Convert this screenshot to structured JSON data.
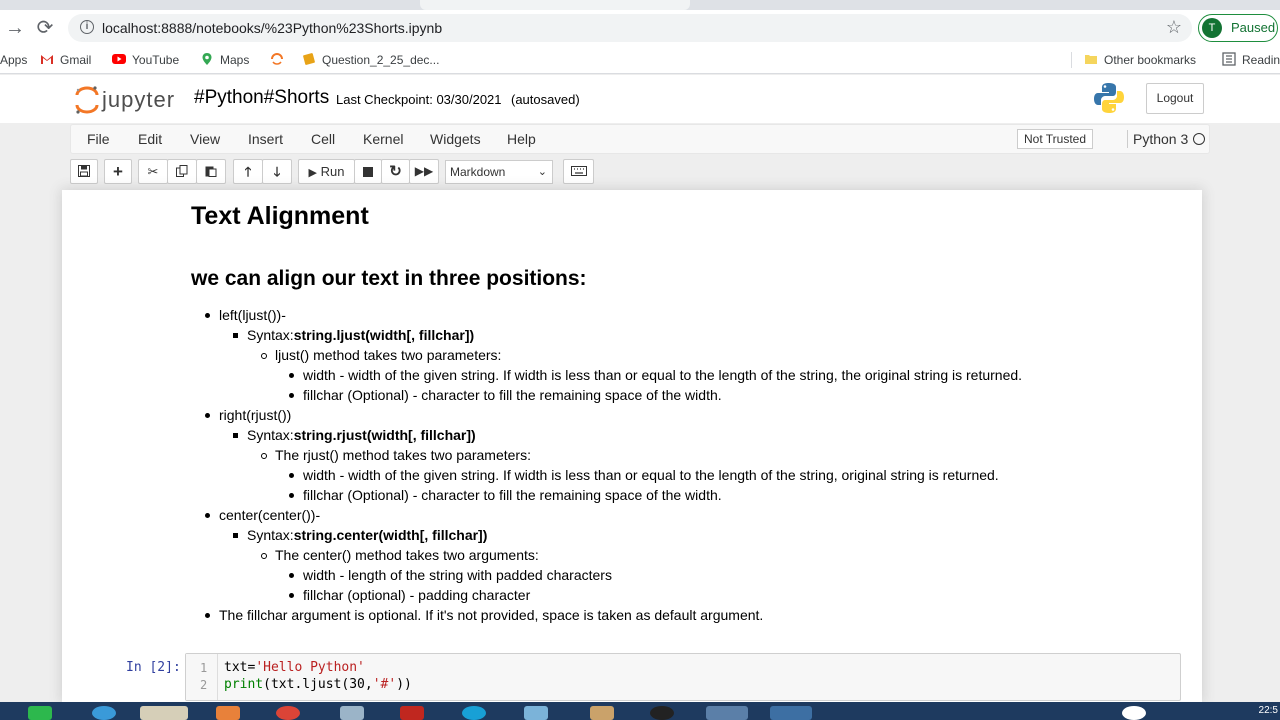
{
  "browser": {
    "url": "localhost:8888/notebooks/%23Python%23Shorts.ipynb",
    "profile_initial": "T",
    "profile_status": "Paused",
    "bookmarks": [
      "Apps",
      "Gmail",
      "YouTube",
      "Maps",
      "Question_2_25_dec...",
      "Other bookmarks",
      "Readin"
    ]
  },
  "jupyter": {
    "logo_text": "jupyter",
    "notebook_name": "#Python#Shorts",
    "checkpoint": "Last Checkpoint: 03/30/2021",
    "autosaved": "(autosaved)",
    "logout": "Logout",
    "menu": [
      "File",
      "Edit",
      "View",
      "Insert",
      "Cell",
      "Kernel",
      "Widgets",
      "Help"
    ],
    "trusted": "Not Trusted",
    "kernel": "Python 3",
    "run_label": "Run",
    "cell_type": "Markdown"
  },
  "content": {
    "h1": "Text Alignment",
    "h2": "we can align our text in three positions:",
    "lines": [
      {
        "plain": "left(ljust())-",
        "bold": ""
      },
      {
        "plain": "Syntax:",
        "bold": "string.ljust(width[, fillchar])"
      },
      {
        "plain": "ljust() method takes two parameters:",
        "bold": ""
      },
      {
        "plain": "width - width of the given string. If width is less than or equal to the length of the string, the original string is returned.",
        "bold": ""
      },
      {
        "plain": "fillchar (Optional) - character to fill the remaining space of the width.",
        "bold": ""
      },
      {
        "plain": "right(rjust())",
        "bold": ""
      },
      {
        "plain": "Syntax:",
        "bold": "string.rjust(width[, fillchar])"
      },
      {
        "plain": "The rjust() method takes two parameters:",
        "bold": ""
      },
      {
        "plain": "width - width of the given string. If width is less than or equal to the length of the string, original string is returned.",
        "bold": ""
      },
      {
        "plain": "fillchar (Optional) - character to fill the remaining space of the width.",
        "bold": ""
      },
      {
        "plain": "center(center())-",
        "bold": ""
      },
      {
        "plain": "Syntax:",
        "bold": "string.center(width[, fillchar])"
      },
      {
        "plain": "The center() method takes two arguments:",
        "bold": ""
      },
      {
        "plain": "width - length of the string with padded characters",
        "bold": ""
      },
      {
        "plain": "fillchar (optional) - padding character",
        "bold": ""
      },
      {
        "plain": "The fillchar argument is optional. If it's not provided, space is taken as default argument.",
        "bold": ""
      }
    ]
  },
  "code_cell": {
    "prompt": "In [2]:",
    "line_numbers": [
      "1",
      "2"
    ],
    "line1_a": "txt=",
    "line1_str": "'Hello Python'",
    "line2_kw": "print",
    "line2_a": "(txt.ljust(30,",
    "line2_str": "'#'",
    "line2_b": "))"
  },
  "taskbar": {
    "clock": "22:5"
  }
}
